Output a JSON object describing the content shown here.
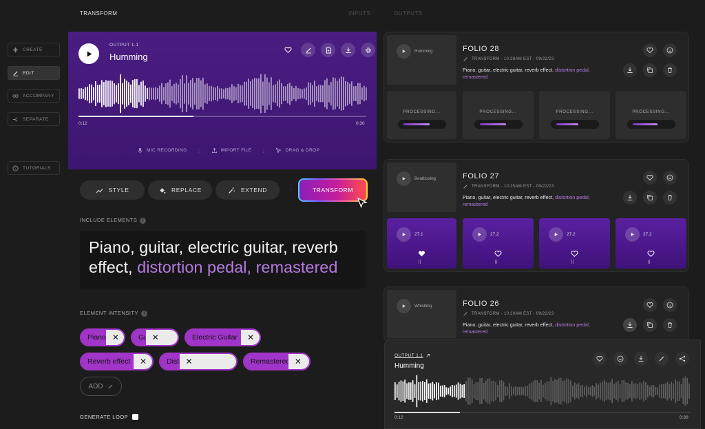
{
  "header": {
    "title": "TRANSFORM",
    "tabs": [
      "INPUTS",
      "OUTPUTS"
    ]
  },
  "sidebar": {
    "items": [
      {
        "label": "CREATE",
        "icon": "create-icon"
      },
      {
        "label": "EDIT",
        "icon": "edit-icon",
        "active": true
      },
      {
        "label": "ACCOMPANY",
        "icon": "accompany-icon"
      },
      {
        "label": "SEPARATE",
        "icon": "separate-icon"
      },
      {
        "label": "TUTORIALS",
        "icon": "help-icon"
      }
    ]
  },
  "player": {
    "output_label": "OUTPUT 1.1",
    "title": "Humming",
    "time_current": "0:12",
    "time_total": "0:30",
    "progress": 0.4,
    "sources": [
      "MIC RECORDING",
      "IMPORT FILE",
      "DRAG & DROP"
    ]
  },
  "tools": {
    "style": "STYLE",
    "replace": "REPLACE",
    "extend": "EXTEND",
    "transform": "TRANSFORM"
  },
  "elements": {
    "label": "INCLUDE ELEMENTS",
    "text_plain": "Piano, guitar, electric guitar, reverb effect, ",
    "text_highlight": "distortion pedal, remastered"
  },
  "intensity": {
    "label": "ELEMENT INTENSITY",
    "chips": [
      {
        "label": "Piano",
        "level": 0.78
      },
      {
        "label": "Guitar",
        "level": 0.3
      },
      {
        "label": "Electric Guitar",
        "level": 0.9
      },
      {
        "label": "Reverb effect",
        "level": 0.78
      },
      {
        "label": "Distortion Pedal",
        "level": 0.25
      },
      {
        "label": "Remastered",
        "level": 0.68
      }
    ],
    "add_label": "ADD"
  },
  "loop": {
    "label": "GENERATE LOOP"
  },
  "folios": [
    {
      "title": "FOLIO 28",
      "source": "Humming",
      "meta": "TRANSFORM - 10:28AM EST - 09/22/23",
      "desc_plain": "Piano, guitar, electric guitar, reverb effect, ",
      "desc_hl": "distortion pedal, remastered",
      "processing": [
        "PROCESSING...",
        "PROCESSING...",
        "PROCESSING...",
        "PROCESSING..."
      ]
    },
    {
      "title": "FOLIO 27",
      "source": "Beatboxing",
      "meta": "TRANSFORM - 10:25AM EST - 09/22/23",
      "desc_plain": "Piano, guitar, electric guitar, reverb effect, ",
      "desc_hl": "distortion pedal, remastered",
      "outputs": [
        "27.1",
        "27.2",
        "27.2",
        "27.2"
      ]
    },
    {
      "title": "FOLIO 26",
      "source": "Whistling",
      "meta": "TRANSFORM - 10:20AM EST - 09/22/23",
      "desc_plain": "Piano, guitar, electric guitar, reverb effect, ",
      "desc_hl": "distortion pedal, remastered"
    }
  ],
  "mini": {
    "output_label": "OUTPUT 1.1",
    "title": "Humming",
    "time_current": "0:12",
    "time_total": "0:30",
    "progress": 0.22
  },
  "colors": {
    "accent": "#a235c9",
    "purple": "#4a1d82",
    "highlight": "#b57be0"
  }
}
